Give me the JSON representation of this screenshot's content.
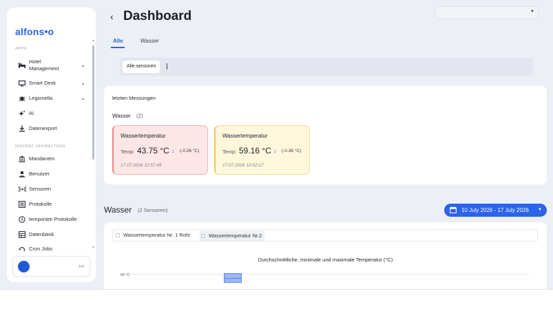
{
  "sidebar": {
    "logo": {
      "before": "alfons",
      "after": "o"
    },
    "apps_label": "APPS",
    "admin_label": "INSTANZ VERWALTUNG",
    "items": [
      {
        "label": "Hotel\nManagement",
        "icon": "bed-icon",
        "expandable": true
      },
      {
        "label": "Smart Desk",
        "icon": "monitor-icon",
        "expandable": true
      },
      {
        "label": "Legionella",
        "icon": "bug-icon",
        "expandable": true
      },
      {
        "label": "AI",
        "icon": "sparkle-icon",
        "expandable": false
      },
      {
        "label": "Datenexport",
        "icon": "download-icon",
        "expandable": false
      },
      {
        "label": "Mandanten",
        "icon": "bank-icon",
        "expandable": false
      },
      {
        "label": "Benutzer",
        "icon": "user-icon",
        "expandable": false
      },
      {
        "label": "Sensoren",
        "icon": "sensor-icon",
        "expandable": false
      },
      {
        "label": "Protokolle",
        "icon": "list-icon",
        "expandable": false
      },
      {
        "label": "temporäre Protokolle",
        "icon": "clock-icon",
        "expandable": false
      },
      {
        "label": "Datenbank",
        "icon": "database-icon",
        "expandable": false
      },
      {
        "label": "Cron Jobs",
        "icon": "cron-icon",
        "expandable": false
      }
    ]
  },
  "header": {
    "title": "Dashboard",
    "back_icon": "chevron-left-icon"
  },
  "tabs": [
    {
      "label": "Alle",
      "active": true
    },
    {
      "label": "Wasser",
      "active": false
    }
  ],
  "filter": {
    "chip": "Alle sensoren",
    "separator": "|"
  },
  "latest": {
    "title": "letzten Messungen",
    "group": {
      "name": "Wasser",
      "count": "(2)"
    },
    "cards": [
      {
        "title": "Wassertemperatur",
        "temp_label": "Temp:",
        "value": "43.75 °C",
        "delta": "(-0.26 °C)",
        "timestamp": "17.07.2026 10:57:45",
        "status_color": "#e88a8a"
      },
      {
        "title": "Wassertemperatur",
        "temp_label": "Temp:",
        "value": "59.16 °C",
        "delta": "(-0.36 °C)",
        "timestamp": "17.07.2026 10:52:17",
        "status_color": "#ecc95a"
      }
    ]
  },
  "section": {
    "title": "Wasser",
    "subtitle": "(2 Sensoren)",
    "date_range": "10 July 2026 - 17 July 2026"
  },
  "chart_panel": {
    "series_toggles": [
      "Wassertemperatur Nr. 1 Rohr",
      "Wassertemperatur Nr.2"
    ]
  },
  "chart_data": {
    "type": "bar",
    "title": "Durchschnittliche, minimale und maximale Temperatur (°C)",
    "y_ticks": [
      "60 °C"
    ],
    "series": [
      {
        "name": "Wassertemperatur Nr. 1 Rohr"
      },
      {
        "name": "Wassertemperatur Nr.2"
      }
    ]
  },
  "colors": {
    "accent": "#2a64e8",
    "background": "#eceff6"
  }
}
